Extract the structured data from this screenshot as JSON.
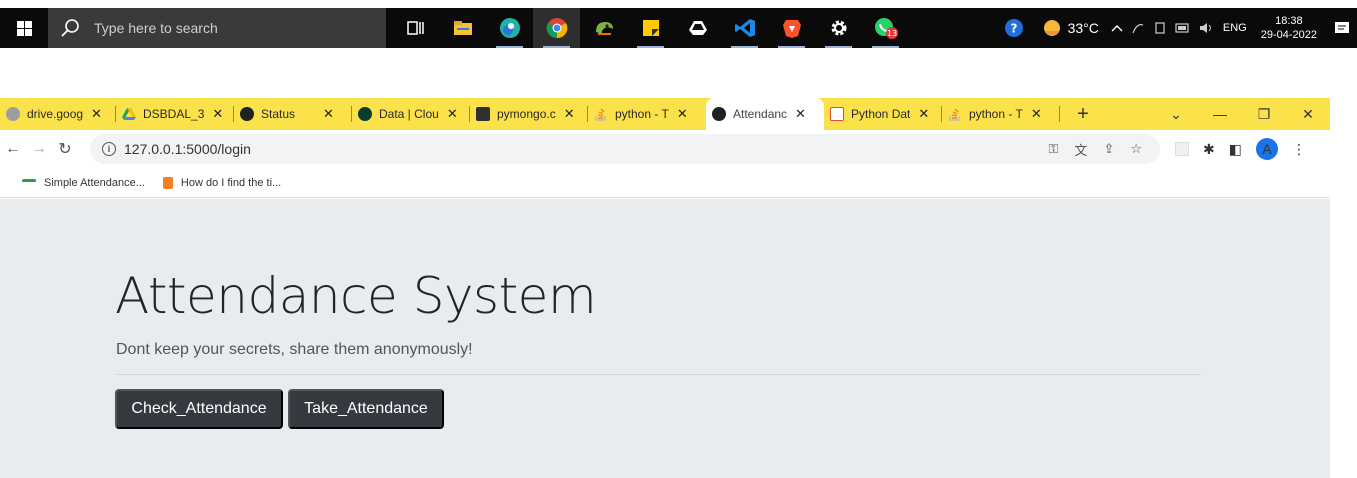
{
  "taskbar": {
    "search_placeholder": "Type here to search",
    "apps": [
      "task-view",
      "file-explorer",
      "edge",
      "chrome",
      "chameleon",
      "sticky-notes",
      "drive",
      "vscode",
      "brave",
      "settings",
      "whatsapp"
    ],
    "whatsapp_badge": "13",
    "weather_temp": "33°C",
    "language": "ENG",
    "time": "18:38",
    "date": "29-04-2022"
  },
  "tabs": [
    {
      "title": "drive.goog",
      "favicon_color": "#9e9e9e"
    },
    {
      "title": "DSBDAL_3",
      "favicon_color": "#1fa463"
    },
    {
      "title": "Status",
      "favicon_color": "#202124"
    },
    {
      "title": "Data | Clou",
      "favicon_color": "#0b3d2e"
    },
    {
      "title": "pymongo.c",
      "favicon_color": "#303030"
    },
    {
      "title": "python - T",
      "favicon_color": "#f48024"
    },
    {
      "title": "Attendanc",
      "favicon_color": "#202124"
    },
    {
      "title": "Python Dat",
      "favicon_color": "#e8453c"
    },
    {
      "title": "python - T",
      "favicon_color": "#f48024"
    }
  ],
  "browser": {
    "url": "127.0.0.1:5000/login",
    "avatar_letter": "A"
  },
  "bookmarks": [
    {
      "label": "Simple Attendance..."
    },
    {
      "label": "How do I find the ti..."
    }
  ],
  "page": {
    "title": "Attendance System",
    "lead": "Dont keep your secrets, share them anonymously!",
    "check_label": "Check_Attendance",
    "take_label": "Take_Attendance"
  }
}
